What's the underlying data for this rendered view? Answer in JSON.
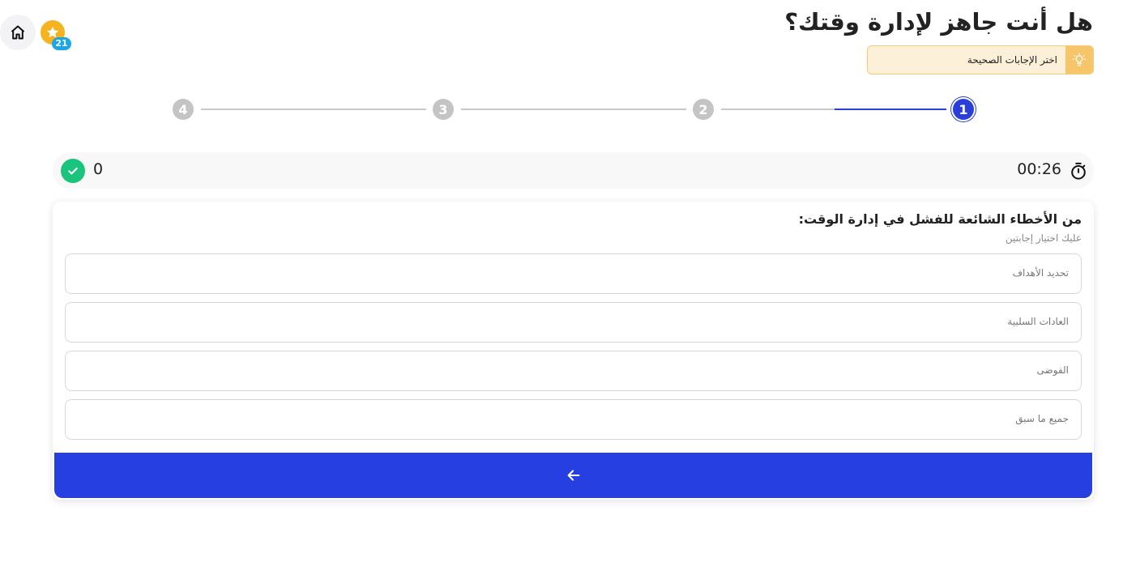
{
  "header": {
    "title": "هل أنت جاهز لإدارة وقتك؟",
    "points_badge": "21",
    "hint_text": "اختر الإجابات الصحيحة"
  },
  "stepper": {
    "steps": [
      "1",
      "2",
      "3",
      "4"
    ],
    "current_step": 1
  },
  "status": {
    "correct_count": "0",
    "timer": "00:26"
  },
  "question": {
    "text": "من الأخطاء الشائعة للفشل في إدارة الوقت:",
    "instruction": "عليك اختيار إجابتين",
    "options": [
      "تحديد الأهداف",
      "العادات السلبية",
      "الفوضى",
      "جميع ما سبق"
    ]
  },
  "colors": {
    "primary": "#263fe0",
    "success": "#1bc47d",
    "star": "#f5b320",
    "badge": "#1ba7e6",
    "hint_bg": "#fdf0d8"
  },
  "icons": {
    "home": "home-icon",
    "star": "star-icon",
    "bulb": "lightbulb-icon",
    "check": "check-icon",
    "timer": "stopwatch-icon",
    "next": "arrow-left-icon"
  }
}
